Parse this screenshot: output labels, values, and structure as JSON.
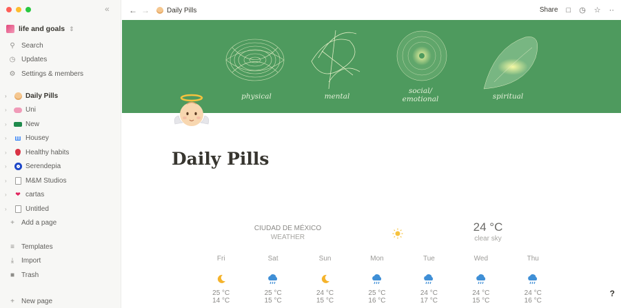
{
  "sidebar": {
    "workspace": "life and goals",
    "top_items": [
      {
        "label": "Search",
        "icon": "search-icon"
      },
      {
        "label": "Updates",
        "icon": "clock-icon"
      },
      {
        "label": "Settings & members",
        "icon": "gear-icon"
      }
    ],
    "pages": [
      {
        "label": "Daily Pills",
        "icon": "angel-emoji"
      },
      {
        "label": "Uni",
        "icon": "brain-emoji"
      },
      {
        "label": "New",
        "icon": "bed-emoji"
      },
      {
        "label": "Housey",
        "icon": "butterfly-emoji"
      },
      {
        "label": "Healthy habits",
        "icon": "strawberry-emoji"
      },
      {
        "label": "Serendepia",
        "icon": "evil-eye-emoji"
      },
      {
        "label": "M&M Studios",
        "icon": "page-icon"
      },
      {
        "label": "cartas",
        "icon": "heart-emoji"
      },
      {
        "label": "Untitled",
        "icon": "page-icon"
      }
    ],
    "add_page": "Add a page",
    "bottom_items": [
      {
        "label": "Templates",
        "icon": "templates-icon"
      },
      {
        "label": "Import",
        "icon": "import-icon"
      },
      {
        "label": "Trash",
        "icon": "trash-icon"
      }
    ],
    "new_page": "New page"
  },
  "topbar": {
    "breadcrumb": "Daily Pills",
    "share": "Share"
  },
  "cover": {
    "labels": [
      "physical",
      "mental",
      "social/",
      "emotional",
      "spiritual"
    ],
    "color": "#4e9a5e"
  },
  "page": {
    "title": "Daily Pills"
  },
  "weather": {
    "city": "CIUDAD DE MÉXICO",
    "subtitle": "WEATHER",
    "temperature": "24 °C",
    "condition": "clear sky",
    "forecast": [
      {
        "day": "Fri",
        "icon": "moon-icon",
        "high": "25 °C",
        "low": "14 °C"
      },
      {
        "day": "Sat",
        "icon": "rain-cloud-icon",
        "high": "25 °C",
        "low": "15 °C"
      },
      {
        "day": "Sun",
        "icon": "moon-icon",
        "high": "24 °C",
        "low": "15 °C"
      },
      {
        "day": "Mon",
        "icon": "rain-cloud-icon",
        "high": "25 °C",
        "low": "16 °C"
      },
      {
        "day": "Tue",
        "icon": "rain-cloud-icon",
        "high": "24 °C",
        "low": "17 °C"
      },
      {
        "day": "Wed",
        "icon": "rain-cloud-icon",
        "high": "24 °C",
        "low": "15 °C"
      },
      {
        "day": "Thu",
        "icon": "rain-cloud-icon",
        "high": "24 °C",
        "low": "16 °C"
      }
    ]
  },
  "help": "?"
}
